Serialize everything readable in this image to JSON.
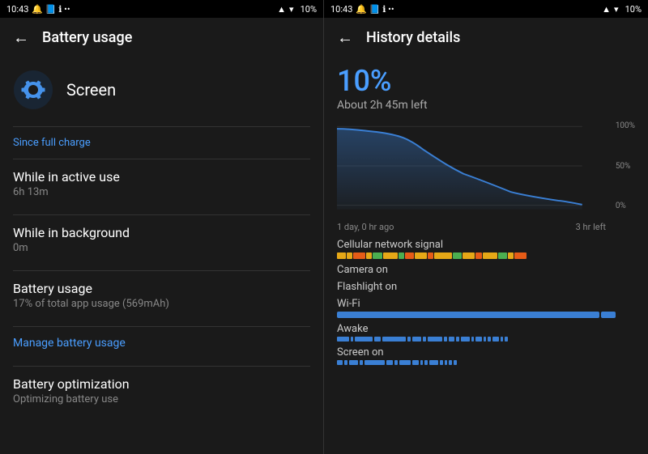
{
  "left": {
    "status_bar": {
      "time": "10:43",
      "battery": "10%"
    },
    "top_bar": {
      "back_label": "←",
      "title": "Battery usage"
    },
    "app": {
      "name": "Screen"
    },
    "section_label": "Since full charge",
    "items": [
      {
        "label": "While in active use",
        "sublabel": "6h 13m"
      },
      {
        "label": "While in background",
        "sublabel": "0m"
      },
      {
        "label": "Battery usage",
        "sublabel": "17% of total app usage (569mAh)"
      }
    ],
    "manage_link": "Manage battery usage",
    "optimization": {
      "label": "Battery optimization",
      "sublabel": "Optimizing battery use"
    }
  },
  "right": {
    "status_bar": {
      "time": "10:43",
      "battery": "10%"
    },
    "top_bar": {
      "back_label": "←",
      "title": "History details"
    },
    "battery_percent": "10%",
    "battery_time_left": "About 2h 45m left",
    "chart": {
      "percent_labels": [
        "100%",
        "50%",
        "0%"
      ],
      "time_labels": [
        "1 day, 0 hr ago",
        "3 hr left"
      ]
    },
    "usage_rows": [
      {
        "label": "Cellular network signal"
      },
      {
        "label": "Camera on"
      },
      {
        "label": "Flashlight on"
      },
      {
        "label": "Wi-Fi"
      },
      {
        "label": "Awake"
      },
      {
        "label": "Screen on"
      }
    ]
  }
}
